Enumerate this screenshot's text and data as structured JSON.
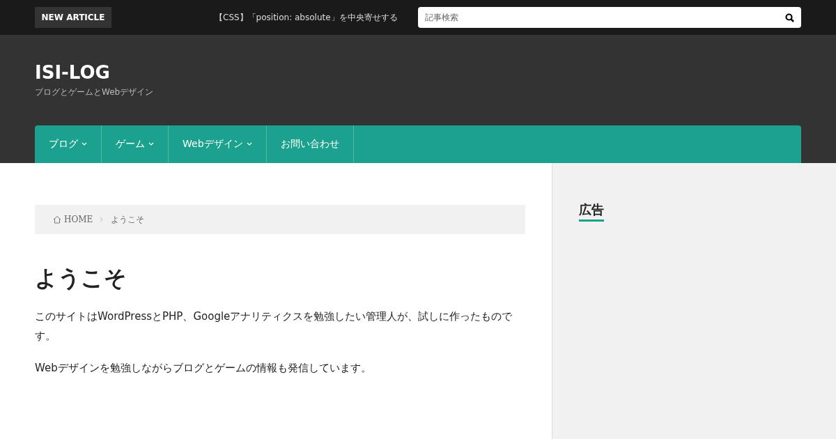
{
  "top_bar": {
    "badge": "NEW ARTICLE",
    "ticker": "【CSS】「position: absolute」を中央寄せする",
    "search": {
      "placeholder": "記事検索"
    }
  },
  "site": {
    "title": "ISI-LOG",
    "tagline": "ブログとゲームとWebデザイン"
  },
  "nav": [
    {
      "label": "ブログ",
      "has_submenu": true
    },
    {
      "label": "ゲーム",
      "has_submenu": true
    },
    {
      "label": "Webデザイン",
      "has_submenu": true
    },
    {
      "label": "お問い合わせ",
      "has_submenu": false
    }
  ],
  "breadcrumb": [
    "HOME",
    "ようこそ"
  ],
  "article": {
    "title": "ようこそ",
    "paragraphs": [
      "このサイトはWordPressとPHP、Googleアナリティクスを勉強したい管理人が、試しに作ったものです。",
      "Webデザインを勉強しながらブログとゲームの情報も発信しています。"
    ]
  },
  "sidebar": {
    "heading": "広告"
  }
}
